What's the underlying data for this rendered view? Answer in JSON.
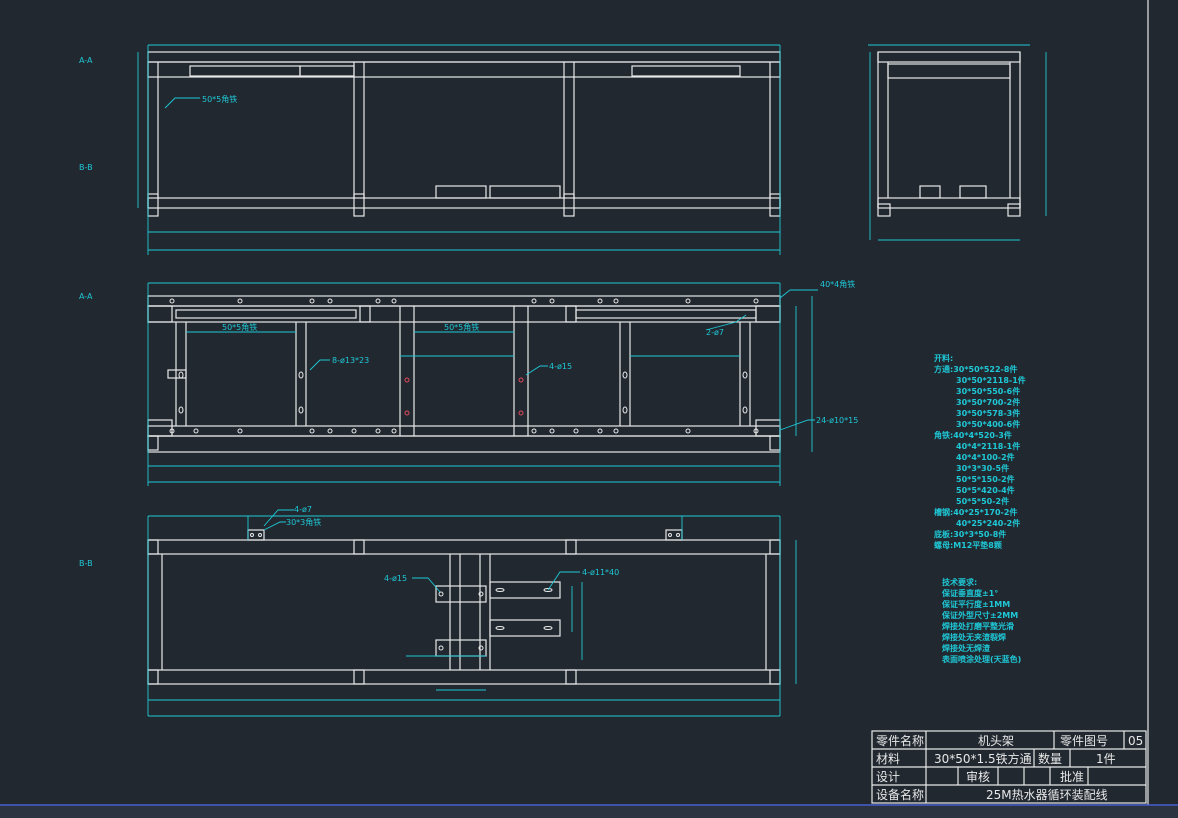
{
  "section_labels": {
    "aa1": "A-A",
    "bb1": "B-B",
    "aa2": "A-A",
    "bb2": "B-B"
  },
  "annotations": {
    "top_angle": "50*5角铁",
    "mid_angle_right": "40*4角铁",
    "mid_angle_left": "50*5角铁",
    "mid_angle_center": "50*5角铁",
    "hole_2_7": "2-ø7",
    "hole_8_13": "8-ø13*23",
    "hole_4_15_mid": "4-ø15",
    "hole_24": "24-ø10*15",
    "hole_4_7": "4-ø7",
    "bot_angle": "30*3角铁",
    "hole_4_15_bot": "4-ø15",
    "hole_4_11": "4-ø11*40"
  },
  "cut_list": [
    "开料:",
    "方通:30*50*522-8件",
    "30*50*2118-1件",
    "30*50*550-6件",
    "30*50*700-2件",
    "30*50*578-3件",
    "30*50*400-6件",
    "角铁:40*4*520-3件",
    "40*4*2118-1件",
    "40*4*100-2件",
    "30*3*30-5件",
    "50*5*150-2件",
    "50*5*420-4件",
    "50*5*50-2件",
    "槽钢:40*25*170-2件",
    "40*25*240-2件",
    "底板:30*3*50-8件",
    "螺母:M12平垫8颗"
  ],
  "tech_requirements": [
    "技术要求:",
    "保证垂直度±1°",
    "保证平行度±1MM",
    "保证外型尺寸±2MM",
    "焊接处打磨平整光滑",
    "焊接处无夹渣裂焊",
    "焊接处无焊渣",
    "表面喷涂处理(天蓝色)"
  ],
  "title_block": {
    "part_name_label": "零件名称",
    "part_name": "机头架",
    "part_no_label": "零件图号",
    "part_no": "05",
    "material_label": "材料",
    "material": "30*50*1.5铁方通",
    "qty_label": "数量",
    "qty": "1件",
    "design_label": "设计",
    "review_label": "审核",
    "approve_label": "批准",
    "equipment_label": "设备名称",
    "equipment": "25M热水器循环装配线"
  },
  "colors": {
    "background": "#212830",
    "geometry": "#e8e8e8",
    "dimension": "#1fc8d6",
    "marker": "#e0485a"
  }
}
